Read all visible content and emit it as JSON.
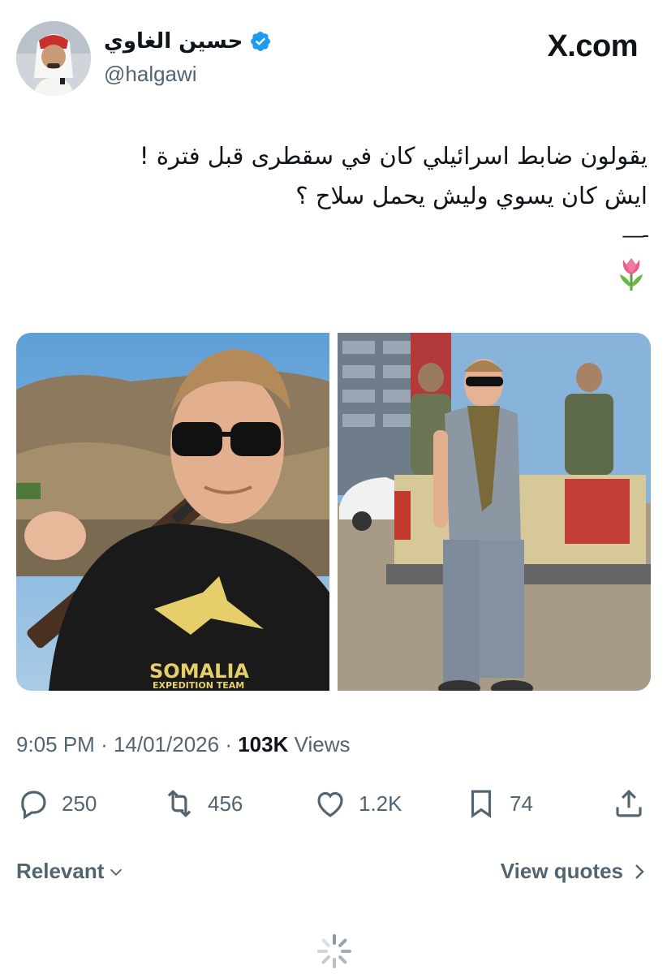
{
  "author": {
    "display_name": "حسين الغاوي",
    "handle": "@halgawi",
    "verified": true,
    "verified_color": "#1d9bf0"
  },
  "brand": {
    "site": "X.com"
  },
  "tweet": {
    "lines": [
      "يقولون ضابط اسرائيلي كان في سقطرى قبل فترة !",
      "ايش كان يسوي وليش يحمل سلاح ؟"
    ],
    "separator": "—-",
    "emoji": "tulip"
  },
  "media": [
    {
      "alt": "",
      "shirt_text_1": "SOMALIA",
      "shirt_text_2": "EXPEDITION TEAM"
    },
    {
      "alt": ""
    }
  ],
  "meta": {
    "time": "9:05 PM",
    "date": "14/01/2026",
    "views_count": "103K",
    "views_label": "Views"
  },
  "actions": {
    "replies": "250",
    "reposts": "456",
    "likes": "1.2K",
    "bookmarks": "74"
  },
  "footer": {
    "sort_label": "Relevant",
    "view_quotes_label": "View quotes"
  },
  "colors": {
    "text_primary": "#0f1419",
    "text_secondary": "#536471",
    "accent": "#1d9bf0"
  }
}
